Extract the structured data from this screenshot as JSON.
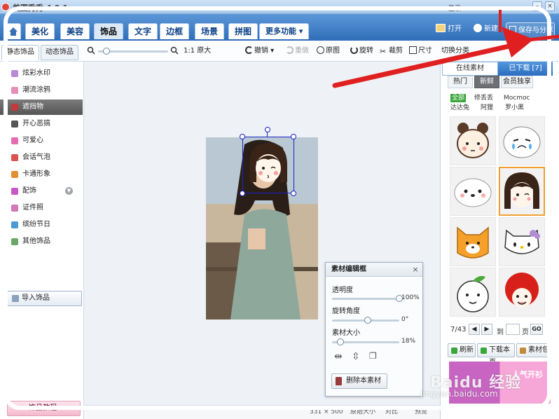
{
  "title": {
    "app_name": "美图秀秀 4.0.1",
    "login": "登录"
  },
  "tabs": [
    {
      "label": "美化"
    },
    {
      "label": "美容"
    },
    {
      "label": "饰品"
    },
    {
      "label": "文字"
    },
    {
      "label": "边框"
    },
    {
      "label": "场景"
    },
    {
      "label": "拼图"
    },
    {
      "label": "更多功能 ▾"
    }
  ],
  "header_actions": {
    "open": "打开",
    "new": "新建",
    "save": "保存与分享"
  },
  "toolbar": {
    "static_tab": "静态饰品",
    "dynamic_tab": "动态饰品",
    "ratio": "1:1 原大",
    "undo": "撤销",
    "redo": "重做",
    "original": "原图",
    "rotate": "旋转",
    "crop": "裁剪",
    "size": "尺寸",
    "switch_category": "切换分类",
    "zoom_level": 0.08
  },
  "sidebar": {
    "items": [
      {
        "label": "炫彩水印",
        "color": "#b98ad8"
      },
      {
        "label": "潮流涂鸦",
        "color": "#e58fb7"
      },
      {
        "label": "遮挡物",
        "color": "#c23a3a"
      },
      {
        "label": "开心恶搞",
        "color": "#555555"
      },
      {
        "label": "可爱心",
        "color": "#e46bb0"
      },
      {
        "label": "会话气泡",
        "color": "#d9534f"
      },
      {
        "label": "卡通形象",
        "color": "#e09030"
      },
      {
        "label": "配饰",
        "color": "#c658c8"
      },
      {
        "label": "证件照",
        "color": "#d078b8"
      },
      {
        "label": "缤纷节日",
        "color": "#4a9ad4"
      },
      {
        "label": "其他饰品",
        "color": "#6aa86a"
      }
    ],
    "selected_index": 2,
    "import_button": "导入饰品",
    "tutorial_button": "饰品教程"
  },
  "editor": {
    "title": "素材编辑框",
    "close": "×",
    "opacity_label": "透明度",
    "opacity_value": "100%",
    "opacity_level": 1.0,
    "rotation_label": "旋转角度",
    "rotation_value": "0°",
    "rotation_level": 0.5,
    "size_label": "素材大小",
    "size_value": "18%",
    "size_level": 0.08,
    "delete_button": "删除本素材"
  },
  "right_panel": {
    "online_tab": "在线素材",
    "downloaded_tab": "已下载 [7]",
    "sub_tabs": [
      "热门",
      "新鲜",
      "会员独享"
    ],
    "active_sub_tab": 1,
    "sources": [
      "全部",
      "修丢丢",
      "Mocmoc",
      "达达兔",
      "阿狸",
      "罗小黑"
    ],
    "active_source": 0,
    "page_text": "7/43",
    "goto_label": "到",
    "page_unit": "页",
    "go": "GO",
    "refresh": "刷新",
    "download_page": "下载本页",
    "material_pack": "素材包",
    "banner_text": "人气开衫"
  },
  "status": {
    "size_text": "331 × 500",
    "original_size": "原始大小",
    "compare": "对比",
    "preview": "预览"
  },
  "watermark": {
    "brand": "Baidu 经验",
    "url": "jingyan.baidu.com"
  },
  "colors": {
    "accent_blue": "#2f6db8",
    "selection_blue": "#1a22c8",
    "arrow_red": "#e02020",
    "selected_orange": "#f0a030"
  }
}
